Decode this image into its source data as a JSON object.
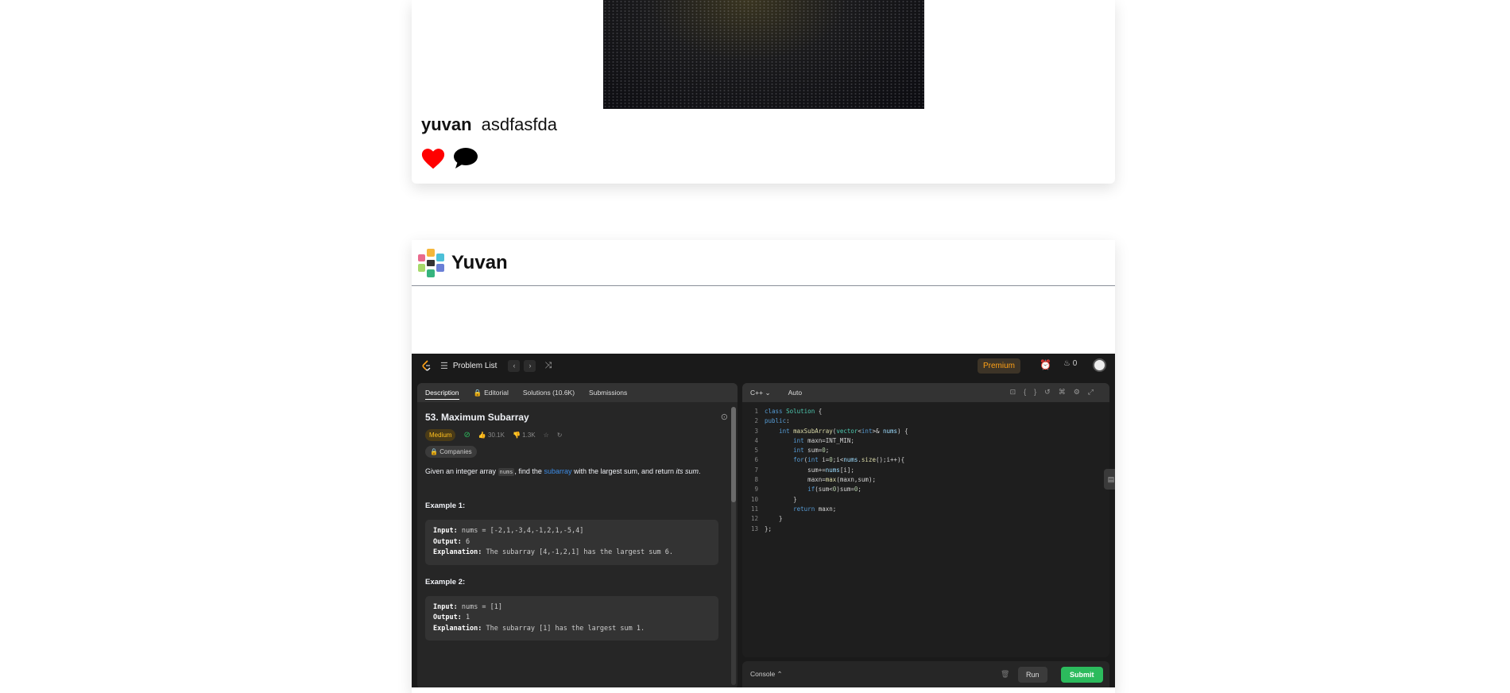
{
  "post1": {
    "username": "yuvan",
    "caption": "asdfasfda",
    "icons": [
      "heart-icon",
      "comment-icon"
    ],
    "heart_color": "#ff0000"
  },
  "post2": {
    "username": "Yuvan",
    "leetcode": {
      "nav": {
        "problem_list": "Problem List",
        "premium": "Premium",
        "streak": "0"
      },
      "tabs": [
        "Description",
        "Editorial",
        "Solutions (10.6K)",
        "Submissions"
      ],
      "problem": {
        "title": "53. Maximum Subarray",
        "difficulty": "Medium",
        "likes": "30.1K",
        "dislikes": "1.3K",
        "companies": "Companies",
        "desc_pre": "Given an integer array ",
        "desc_code": "nums",
        "desc_mid": ", find the ",
        "desc_link": "subarray",
        "desc_post": " with the largest sum, and return ",
        "desc_italic": "its sum",
        "desc_end": "."
      },
      "examples": [
        {
          "title": "Example 1:",
          "input": "nums = [-2,1,-3,4,-1,2,1,-5,4]",
          "output": "6",
          "explanation": "The subarray [4,-1,2,1] has the largest sum 6."
        },
        {
          "title": "Example 2:",
          "input": "nums = [1]",
          "output": "1",
          "explanation": "The subarray [1] has the largest sum 1."
        }
      ],
      "editor": {
        "language": "C++",
        "mode": "Auto",
        "line_numbers": [
          "1",
          "2",
          "3",
          "4",
          "5",
          "6",
          "7",
          "8",
          "9",
          "10",
          "11",
          "12",
          "13"
        ]
      },
      "console": {
        "label": "Console",
        "run": "Run",
        "submit": "Submit"
      }
    }
  }
}
